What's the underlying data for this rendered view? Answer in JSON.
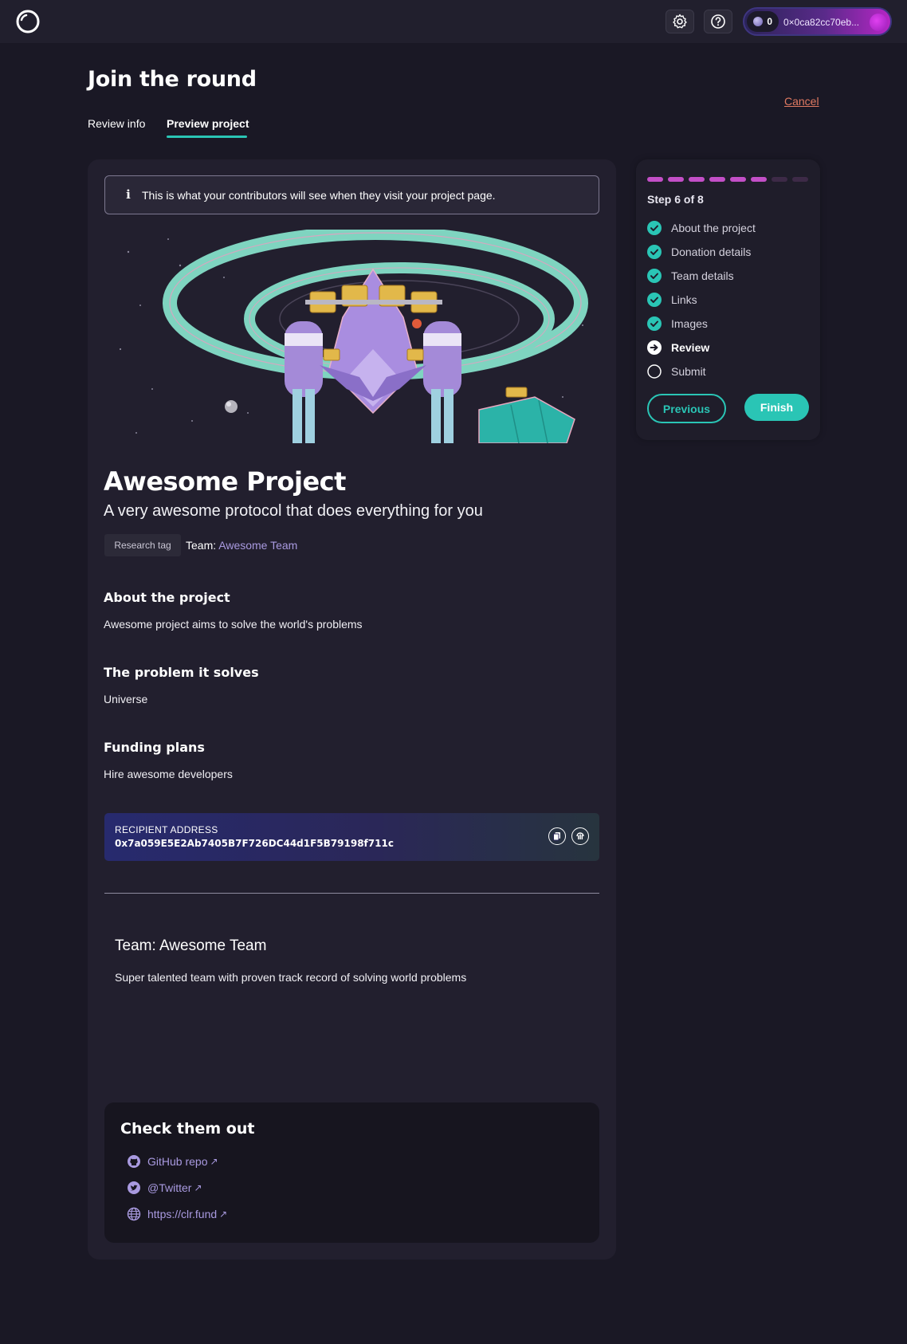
{
  "topbar": {
    "logo_icon": "clr-fund-logo-icon",
    "settings_icon": "gear-icon",
    "help_icon": "question-mark-icon",
    "wallet": {
      "balance": "0",
      "address": "0×0ca82cc70eb..."
    }
  },
  "header": {
    "title": "Join the round",
    "cancel_label": "Cancel",
    "tabs": [
      {
        "label": "Review info",
        "active": false
      },
      {
        "label": "Preview project",
        "active": true
      }
    ]
  },
  "notice": {
    "icon": "info-icon",
    "text": "This is what your contributors will see when they visit your project page."
  },
  "project": {
    "name": "Awesome Project",
    "tagline": "A very awesome protocol that does everything for you",
    "tag": "Research tag",
    "team_label": "Team:",
    "team_name": "Awesome Team",
    "sections": [
      {
        "heading": "About the project",
        "body": "Awesome project aims to solve the world's problems"
      },
      {
        "heading": "The problem it solves",
        "body": "Universe"
      },
      {
        "heading": "Funding plans",
        "body": "Hire awesome developers"
      }
    ],
    "recipient": {
      "label": "RECIPIENT ADDRESS",
      "address": "0x7a059E5E2Ab7405B7F726DC44d1F5B79198f711c",
      "copy_icon": "copy-icon",
      "explorer_icon": "etherscan-icon"
    },
    "team_heading": "Team: Awesome Team",
    "team_description": "Super talented team with proven track record of solving world problems",
    "links": {
      "heading": "Check them out",
      "items": [
        {
          "icon": "github-icon",
          "label": "GitHub repo",
          "ext": "↗"
        },
        {
          "icon": "twitter-icon",
          "label": "@Twitter",
          "ext": "↗"
        },
        {
          "icon": "globe-icon",
          "label": "https://clr.fund",
          "ext": "↗"
        }
      ]
    }
  },
  "stepper": {
    "total_steps": 8,
    "current_step": 6,
    "step_label": "Step 6 of 8",
    "colors": {
      "done": "#c34fc7",
      "pending": "#3d2a47",
      "check": "#2ac5b5"
    },
    "steps": [
      {
        "label": "About the project",
        "state": "done"
      },
      {
        "label": "Donation details",
        "state": "done"
      },
      {
        "label": "Team details",
        "state": "done"
      },
      {
        "label": "Links",
        "state": "done"
      },
      {
        "label": "Images",
        "state": "done"
      },
      {
        "label": "Review",
        "state": "current"
      },
      {
        "label": "Submit",
        "state": "pending"
      }
    ],
    "previous_label": "Previous",
    "finish_label": "Finish"
  }
}
